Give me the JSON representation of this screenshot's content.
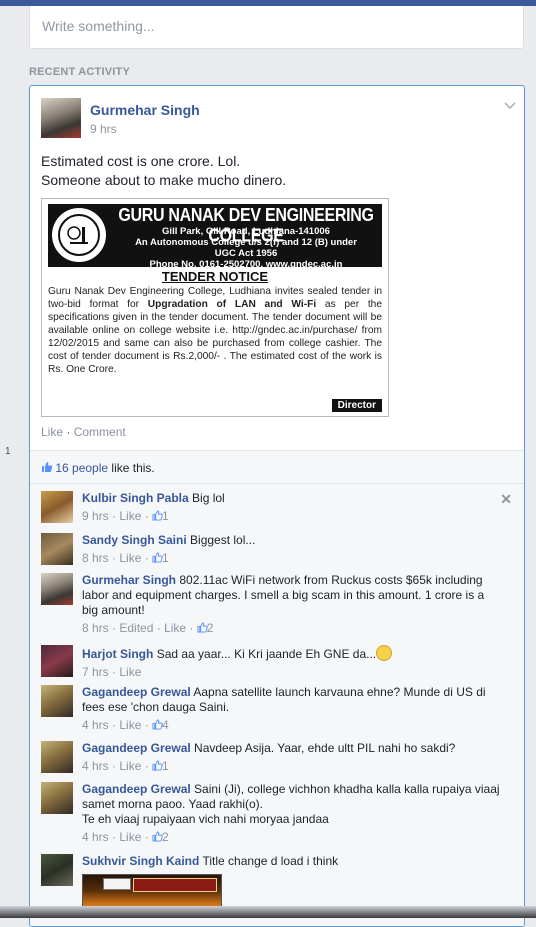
{
  "composer": {
    "placeholder": "Write something..."
  },
  "section_title": "RECENT ACTIVITY",
  "gutter_number": "1",
  "post": {
    "author": "Gurmehar Singh",
    "time": "9 hrs",
    "text_line1": "Estimated cost is one crore. Lol.",
    "text_line2": "Someone about to make mucho dinero.",
    "image": {
      "college_name": "GURU NANAK DEV ENGINEERING COLLEGE",
      "address_line1": "Gill Park, Gill Road, Ludhiana-141006",
      "address_line2": "An Autonomous College u/s 2(f) and 12 (B) under",
      "address_line3": "UGC Act 1956",
      "address_line4": "Phone No. 0161-2502700, www.gndec.ac.in",
      "notice_title": "TENDER NOTICE",
      "body_part1": "Guru Nanak Dev Engineering College, Ludhiana invites sealed tender in two-bid format for ",
      "body_bold": "Upgradation of  LAN and Wi-Fi",
      "body_part2": " as per the specifications given in the tender document. The tender document  will be available online on college website i.e. http://gndec.ac.in/purchase/ from 12/02/2015 and same can also be purchased from college cashier. The cost of tender document is Rs.2,000/- . The estimated cost of the work is Rs. One Crore.",
      "signature": "Director"
    },
    "actions": {
      "like": "Like",
      "separator": " · ",
      "comment": "Comment"
    }
  },
  "likes": {
    "count_text": "16 people",
    "suffix": " like this."
  },
  "comments": [
    {
      "name": "Kulbir Singh Pabla",
      "text": "Big lol",
      "time": "9 hrs",
      "like": "Like",
      "likes": "1"
    },
    {
      "name": "Sandy Singh Saini",
      "text": "Biggest lol...",
      "time": "8 hrs",
      "like": "Like",
      "likes": "1"
    },
    {
      "name": "Gurmehar Singh",
      "text": "802.11ac WiFi network from Ruckus costs $65k including labor and equipment charges. I smell a big scam in this amount. 1 crore is a big amount!",
      "time": "8 hrs",
      "edited": "Edited",
      "like": "Like",
      "likes": "2"
    },
    {
      "name": "Harjot Singh",
      "text": "Sad aa yaar... Ki Kri jaande Eh GNE da...",
      "time": "7 hrs",
      "like": "Like"
    },
    {
      "name": "Gagandeep Grewal",
      "text": "Aapna satellite launch karvauna ehne? Munde di US di fees ese 'chon dauga Saini.",
      "time": "4 hrs",
      "like": "Like",
      "likes": "4"
    },
    {
      "name": "Gagandeep Grewal",
      "text": "Navdeep Asija. Yaar, ehde ultt PIL nahi ho sakdi?",
      "time": "4 hrs",
      "like": "Like",
      "likes": "1"
    },
    {
      "name": "Gagandeep Grewal",
      "text": "Saini (Ji), college vichhon khadha kalla kalla rupaiya viaaj samet morna paoo. Yaad rakhi(o).",
      "text2": "Te eh viaaj rupaiyaan vich nahi moryaa jandaa",
      "time": "4 hrs",
      "like": "Like",
      "likes": "2"
    },
    {
      "name": "Sukhvir Singh Kaind",
      "text": "Title change d load i think"
    }
  ],
  "colors": {
    "brand": "#3b5998",
    "link": "#365899",
    "muted": "#90949c",
    "card_border": "#5b9bd5"
  },
  "icons": {
    "thumb": "thumbs-up-icon",
    "close": "close-icon",
    "chevron": "chevron-down-icon",
    "emoji": "sad-face-icon"
  }
}
